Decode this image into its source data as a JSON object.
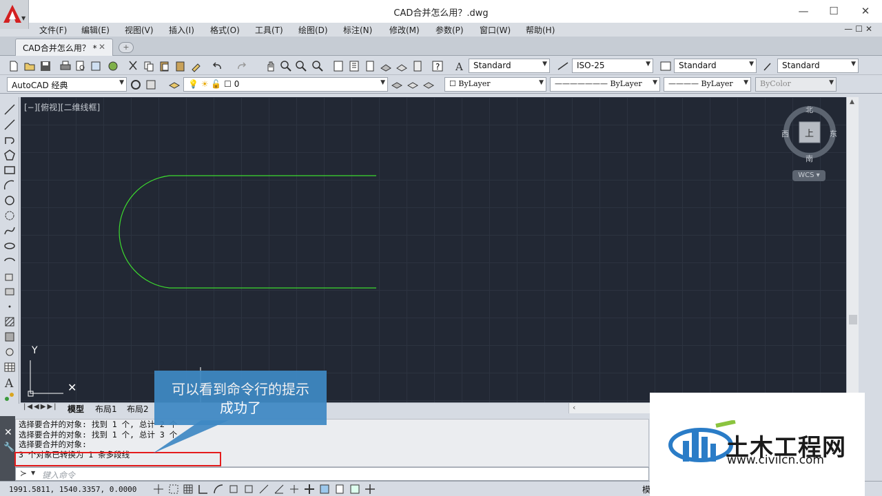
{
  "window": {
    "title": "CAD合并怎么用？.dwg",
    "min": "—",
    "max": "☐",
    "close": "✕"
  },
  "menu": [
    "文件(F)",
    "编辑(E)",
    "视图(V)",
    "插入(I)",
    "格式(O)",
    "工具(T)",
    "绘图(D)",
    "标注(N)",
    "修改(M)",
    "参数(P)",
    "窗口(W)",
    "帮助(H)"
  ],
  "tabs": {
    "active": "CAD合并怎么用？ *",
    "close": "✕",
    "new": "+"
  },
  "toolbar": {
    "text_style": "Standard",
    "dim_style": "ISO-25",
    "table_style": "Standard",
    "mleader_style": "Standard",
    "workspace": "AutoCAD 经典",
    "layer": "0",
    "color": "ByLayer",
    "linetype": "ByLayer",
    "lineweight": "ByLayer",
    "plotstyle": "ByColor"
  },
  "viewport": {
    "label": "[−][俯视][二维线框]"
  },
  "viewcube": {
    "north": "北",
    "south": "南",
    "east": "东",
    "west": "西",
    "top": "上",
    "wcs": "WCS ▾"
  },
  "ucs": {
    "y": "Y",
    "x": "X"
  },
  "layout_tabs": [
    "模型",
    "布局1",
    "布局2"
  ],
  "command": {
    "history": [
      "选择要合并的对象: 找到 1 个, 总计 2 个",
      "选择要合并的对象: 找到 1 个, 总计 3 个",
      "选择要合并的对象:",
      "3 个对象已转换为 1 条多段线"
    ],
    "placeholder": "键入命令",
    "prompt_icon": "≻"
  },
  "annotation": {
    "line1": "可以看到命令行的提示",
    "line2": "成功了"
  },
  "status": {
    "coordinates": "1991.5811, 1540.3357, 0.0000",
    "model": "模"
  },
  "watermark": {
    "title": "土木工程网",
    "url": "www.civilcn.com"
  },
  "colors": {
    "canvas": "#222834",
    "grid": "#2c3340",
    "polyline": "#3ddc2f",
    "callout": "#3f89c4",
    "highlight": "#e41c1c"
  }
}
